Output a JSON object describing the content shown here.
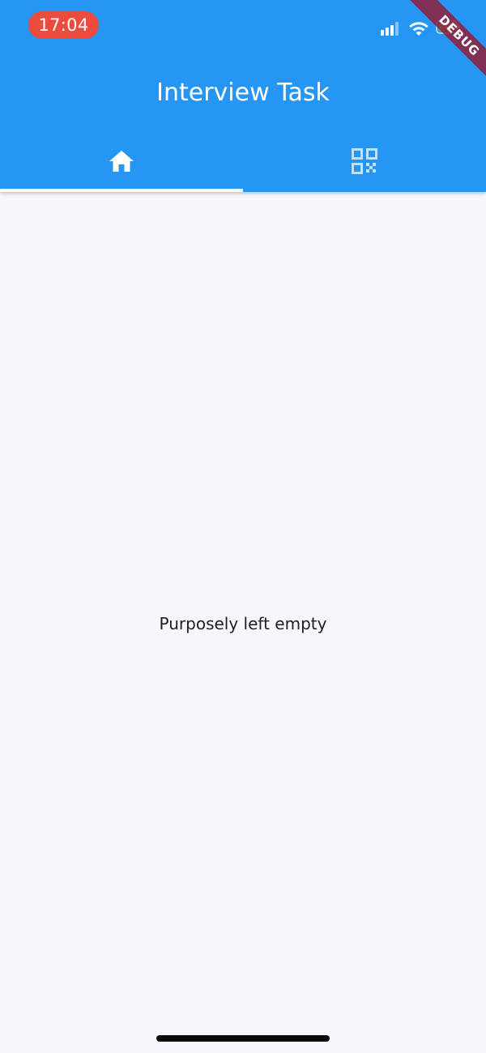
{
  "status_bar": {
    "time": "17:04",
    "icons": [
      "cellular-signal-icon",
      "wifi-icon",
      "battery-charging-icon"
    ]
  },
  "debug_banner": {
    "label": "DEBUG"
  },
  "app_bar": {
    "title": "Interview Task",
    "background_color": "#2596f3"
  },
  "tabs": [
    {
      "icon": "home-icon",
      "selected": true
    },
    {
      "icon": "qr-code-icon",
      "selected": false
    }
  ],
  "content": {
    "message": "Purposely left empty"
  },
  "colors": {
    "time_pill": "#eb4c3d",
    "page_background": "#f9f7fb"
  }
}
